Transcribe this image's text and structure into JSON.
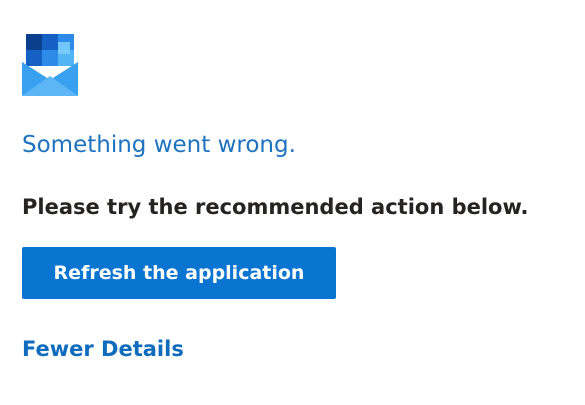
{
  "icons": {
    "app_logo": "outlook-envelope-icon"
  },
  "colors": {
    "title_blue": "#1e73be",
    "button_blue": "#0a75d1",
    "link_blue": "#0f6cbd",
    "text_dark": "#252423"
  },
  "error": {
    "title": "Something went wrong.",
    "instruction": "Please try the recommended action below."
  },
  "actions": {
    "refresh_label": "Refresh the application",
    "details_toggle_label": "Fewer Details"
  }
}
